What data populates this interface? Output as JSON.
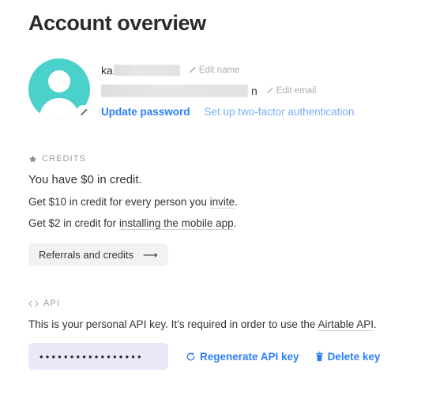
{
  "page": {
    "title": "Account overview"
  },
  "profile": {
    "avatar_icon": "person-avatar-icon",
    "avatar_color": "#4ad1cb",
    "avatar_edit_icon": "pencil-icon",
    "name_visible_prefix": "ka",
    "name_redacted": true,
    "email_visible_suffix": "n",
    "email_redacted": true,
    "edit_name_label": "Edit name",
    "edit_name_icon": "pencil-icon",
    "edit_email_label": "Edit email",
    "edit_email_icon": "pencil-icon",
    "update_password_label": "Update password",
    "two_factor_label": "Set up two-factor authentication",
    "link_color": "#2d7ff9",
    "link_muted_color": "#7aaefb"
  },
  "credits": {
    "section_icon": "star-icon",
    "section_label": "CREDITS",
    "headline": "You have $0 in credit.",
    "lines": [
      {
        "before": "Get $10 in credit for every person you ",
        "link": "invite",
        "after": "."
      },
      {
        "before": "Get $2 in credit for ",
        "link": "installing the mobile app",
        "after": "."
      }
    ],
    "button_label": "Referrals and credits",
    "button_icon": "arrow-right-icon"
  },
  "api": {
    "section_icon": "code-brackets-icon",
    "section_label": "API",
    "description_before": "This is your personal API key. It’s required in order to use the ",
    "description_link": "Airtable API",
    "description_after": ".",
    "key_masked": "•••••••••••••••••",
    "key_field_bg": "#ece6f9",
    "regenerate_label": "Regenerate API key",
    "regenerate_icon": "refresh-icon",
    "delete_label": "Delete key",
    "delete_icon": "trash-icon"
  }
}
